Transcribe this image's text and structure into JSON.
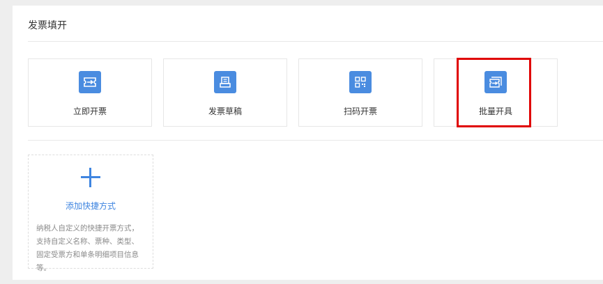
{
  "section": {
    "title": "发票填开"
  },
  "cards": [
    {
      "label": "立即开票",
      "icon": "invoice-arrow-icon"
    },
    {
      "label": "发票草稿",
      "icon": "draft-icon"
    },
    {
      "label": "扫码开票",
      "icon": "qr-code-icon"
    },
    {
      "label": "批量开具",
      "icon": "batch-invoice-icon"
    }
  ],
  "add_shortcut": {
    "label": "添加快捷方式",
    "description": "纳税人自定义的快捷开票方式，支持自定义名称、票种、类型、固定受票方和单条明细项目信息等。",
    "icon": "plus-icon"
  },
  "colors": {
    "accent": "#4a8ce0",
    "highlight": "#e00000",
    "link": "#3f85e0"
  }
}
